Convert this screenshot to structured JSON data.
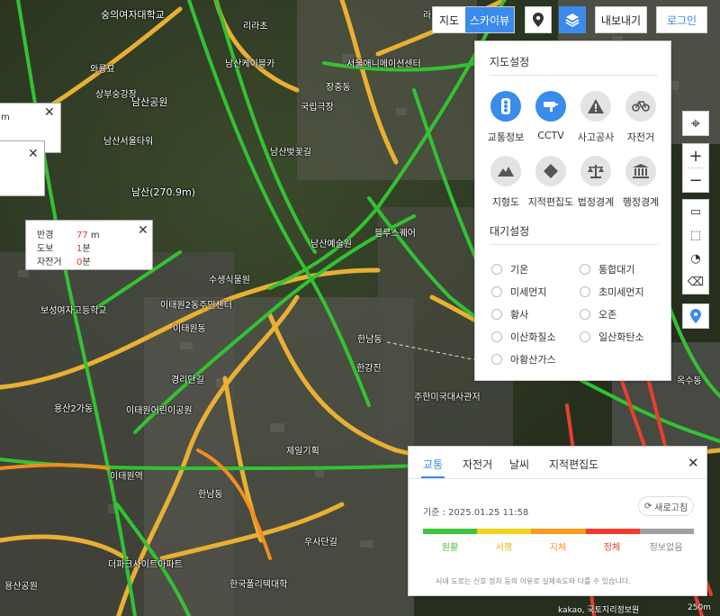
{
  "toolbar": {
    "map_type_map": "지도",
    "map_type_skyview": "스카이뷰",
    "export_label": "내보내기",
    "login_label": "로그인"
  },
  "map_settings": {
    "title": "지도설정",
    "layers": [
      {
        "label": "교통정보",
        "icon": "traffic-light-icon",
        "active": true
      },
      {
        "label": "CCTV",
        "icon": "cctv-icon",
        "active": true
      },
      {
        "label": "사고공사",
        "icon": "warning-icon",
        "active": false
      },
      {
        "label": "자전거",
        "icon": "bicycle-icon",
        "active": false
      },
      {
        "label": "지형도",
        "icon": "mountain-icon",
        "active": false
      },
      {
        "label": "지적편집도",
        "icon": "cadastral-icon",
        "active": false
      },
      {
        "label": "법정경계",
        "icon": "scale-icon",
        "active": false
      },
      {
        "label": "행정경계",
        "icon": "government-icon",
        "active": false
      }
    ],
    "air_title": "대기설정",
    "air_options": [
      "기온",
      "통합대기",
      "미세먼지",
      "초미세먼지",
      "황사",
      "오존",
      "이산화질소",
      "일산화탄소",
      "아황산가스"
    ]
  },
  "distance_popup": {
    "rows": [
      {
        "key": "반경",
        "value": "77",
        "unit": "m"
      },
      {
        "key": "도보",
        "value": "1",
        "unit": "분"
      },
      {
        "key": "자전거",
        "value": "0",
        "unit": "분"
      }
    ],
    "small_popup_text": "m"
  },
  "traffic_panel": {
    "tabs": [
      "교통",
      "자전거",
      "날씨",
      "지적편집도"
    ],
    "timestamp": "기준 : 2025.01.25 11:58",
    "refresh_label": "새로고침",
    "legend": [
      {
        "label": "원활",
        "color": "#3ec63e"
      },
      {
        "label": "서행",
        "color": "#f6d21c"
      },
      {
        "label": "지체",
        "color": "#f79b1d"
      },
      {
        "label": "정체",
        "color": "#ee3b2e"
      },
      {
        "label": "정보없음",
        "color": "#a0a0a0"
      }
    ],
    "notice": "시내 도로는 신호 정차 등의 이유로 실제속도와 다를 수 있습니다."
  },
  "copyright": "kakao, 국토지리정보원",
  "scale_label": "250m",
  "map_labels": [
    "숭의여자대학교",
    "리라초",
    "와룡묘",
    "상부숭강장",
    "남산공원",
    "남산서울타워",
    "남산(270.9m)",
    "남산케이블카",
    "서울애니메이션센터",
    "국립극장",
    "남산벚꽃길",
    "남산예술원",
    "수생식물원",
    "이태원2동주민센터",
    "경리단길",
    "한남동",
    "이태원동",
    "한강진",
    "블루스퀘어",
    "용산2가동",
    "이태원어린이공원",
    "제일기획",
    "주한미국대사관저",
    "더파크사이트아파트",
    "우사단길",
    "한국폴리텍대학",
    "용산공원",
    "보성여자고등학교",
    "옥수동",
    "한남동",
    "라비두스",
    "장충동",
    "이태원역",
    "남산서울타워"
  ]
}
